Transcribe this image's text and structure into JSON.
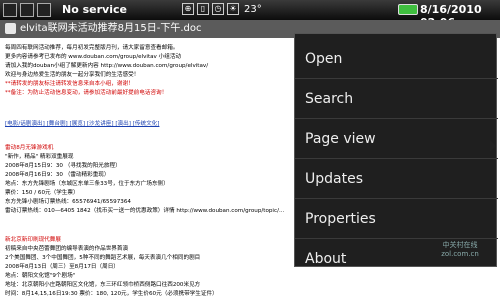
{
  "status_bar": {
    "service": "No service",
    "temperature": "23°",
    "time": "8/16/2010 02:06",
    "battery_level": 1.0
  },
  "browser": {
    "title": "elvita联网未活动推荐8月15日-下午.doc"
  },
  "document": {
    "lines": [
      "每周四有联网活动推荐，每月初发完整版月刊，请大家留意查看邮箱。",
      "更多内容请参考已发布的 www.douban.com/group/elvitav 小组活动",
      "请加入我的douban小组了解更新内容 http://www.douban.com/group/elvitav/",
      "欢迎与身边热爱生活的朋友一起分享我们的生活感受！",
      "**请转发的朋友标注请转发信息来自本小组，谢谢！",
      "**备注：为防止活动信息变动，请参加活动前最好提前电话咨询！"
    ],
    "categories": "[电影/话剧演出]  [舞台剧]  [展览]  [沙龙讲座]  [演出]  [传统文化]",
    "section1_title": "雷动8月无锋游戏机",
    "section1_lines": [
      "\"新作，精品\" 精彩双重展现",
      "2008年8月15日9：30      （寻找我的阳光旅程）",
      "2008年8月16日9：30      （雷动精彩重现）",
      "地点：东方先锋剧场（东城区东单三条33号，位于东方广场东侧）",
      "票价：150 / 60元（学生票）",
      "东方先锋小剧场订票热线：65576941/65597364",
      "雷动订票热线：010—6405 1842（找币买一送一的优惠政策）详情 http://www.douban.com/group/topic/..."
    ],
    "section2_title": "新北京新印刷现代舞展",
    "section2_lines": [
      "初稿来自中央芭蕾舞团的编导表演的作品世界首演",
      "2个美国舞团、3个中国舞团，5种不同的舞蹈艺术展，每天表演几个相同的剧目",
      "2008年8月13日（周三）至8月17日（周日）",
      "地点：朝阳文化馆\"9个剧场\"",
      "地址：北京朝阳小庄路朝阳区文化馆，东三环红领巾桥西侧路口往西200米见方",
      "时间：8月14,15,16日19:30   票价：180, 120元，学生价60元（必须携带学生证件）"
    ]
  },
  "menu": {
    "items": [
      "Open",
      "Search",
      "Page view",
      "Updates",
      "Properties",
      "About"
    ]
  },
  "watermark": "中关村在线 zol.com.cn"
}
